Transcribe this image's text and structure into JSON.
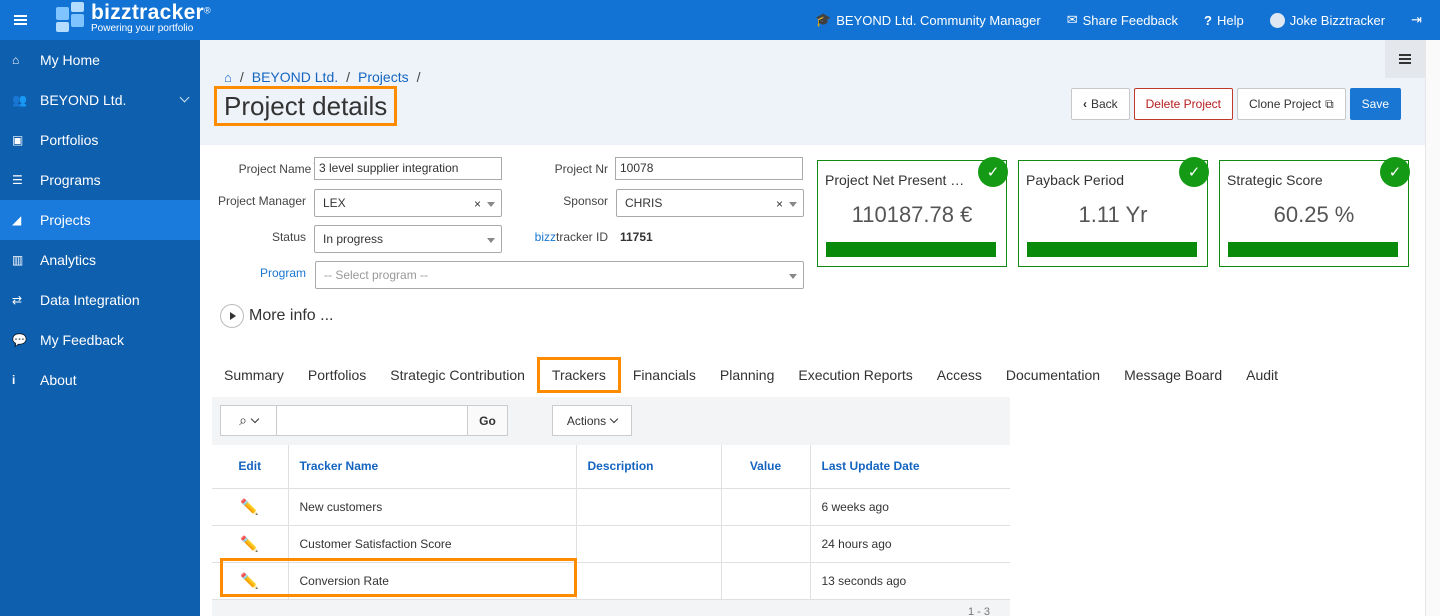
{
  "topbar": {
    "brand_name": "bizztracker",
    "brand_trademark": "®",
    "brand_tagline": "Powering your portfolio",
    "community": "BEYOND Ltd. Community Manager",
    "feedback": "Share Feedback",
    "help": "Help",
    "user": "Joke Bizztracker"
  },
  "sidebar": {
    "items": [
      {
        "label": "My Home",
        "icon": "home-icon"
      },
      {
        "label": "BEYOND Ltd.",
        "icon": "users-icon"
      },
      {
        "label": "Portfolios",
        "icon": "briefcase-icon"
      },
      {
        "label": "Programs",
        "icon": "list-icon"
      },
      {
        "label": "Projects",
        "icon": "area-chart-icon"
      },
      {
        "label": "Analytics",
        "icon": "bar-chart-icon"
      },
      {
        "label": "Data Integration",
        "icon": "exchange-icon"
      },
      {
        "label": "My Feedback",
        "icon": "comments-icon"
      },
      {
        "label": "About",
        "icon": "info-icon"
      }
    ],
    "active": "Projects"
  },
  "breadcrumb": [
    "BEYOND Ltd.",
    "Projects"
  ],
  "page_title": "Project details",
  "buttons": {
    "back": "Back",
    "delete": "Delete Project",
    "clone": "Clone Project",
    "save": "Save"
  },
  "form": {
    "project_name_label": "Project Name",
    "project_name_value": "3 level supplier integration",
    "project_nr_label": "Project Nr",
    "project_nr_value": "10078",
    "manager_label": "Project Manager",
    "manager_value": "LEX",
    "sponsor_label": "Sponsor",
    "sponsor_value": "CHRIS",
    "status_label": "Status",
    "status_value": "In progress",
    "id_label_link": "bizz",
    "id_label_rest": "tracker ID",
    "id_value": "11751",
    "program_label": "Program",
    "program_placeholder": "-- Select program --"
  },
  "kpis": [
    {
      "title": "Project Net Present Value",
      "value": "110187.78 €"
    },
    {
      "title": "Payback Period",
      "value": "1.11 Yr"
    },
    {
      "title": "Strategic Score",
      "value": "60.25 %"
    }
  ],
  "more_info": "More info ...",
  "tabs": [
    "Summary",
    "Portfolios",
    "Strategic Contribution",
    "Trackers",
    "Financials",
    "Planning",
    "Execution Reports",
    "Access",
    "Documentation",
    "Message Board",
    "Audit"
  ],
  "active_tab": "Trackers",
  "trackers": {
    "go": "Go",
    "actions": "Actions",
    "columns": [
      "Edit",
      "Tracker Name",
      "Description",
      "Value",
      "Last Update Date"
    ],
    "rows": [
      {
        "name": "New customers",
        "description": "",
        "value": "",
        "updated": "6 weeks ago"
      },
      {
        "name": "Customer Satisfaction Score",
        "description": "",
        "value": "",
        "updated": "24 hours ago"
      },
      {
        "name": "Conversion Rate",
        "description": "",
        "value": "",
        "updated": "13 seconds ago"
      }
    ],
    "pager": "1 - 3"
  },
  "colors": {
    "topbar": "#1273d4",
    "sidebar": "#0e5fae",
    "sidebar_active": "#1a7bdc",
    "highlight": "#ff8c00",
    "kpi_green": "#118a11"
  }
}
